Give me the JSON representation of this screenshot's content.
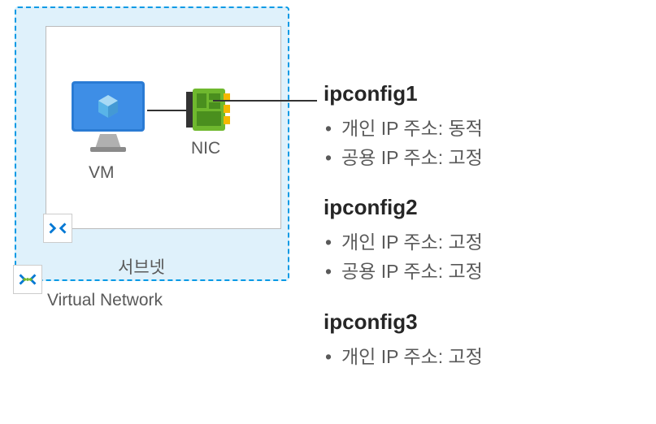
{
  "vnet": {
    "label": "Virtual Network"
  },
  "subnet": {
    "label": "서브넷"
  },
  "vm": {
    "label": "VM"
  },
  "nic": {
    "label": "NIC"
  },
  "configs": [
    {
      "name": "ipconfig1",
      "items": [
        "개인 IP 주소: 동적",
        "공용 IP 주소: 고정"
      ]
    },
    {
      "name": "ipconfig2",
      "items": [
        "개인 IP 주소: 고정",
        "공용 IP 주소: 고정"
      ]
    },
    {
      "name": "ipconfig3",
      "items": [
        "개인 IP 주소: 고정"
      ]
    }
  ]
}
